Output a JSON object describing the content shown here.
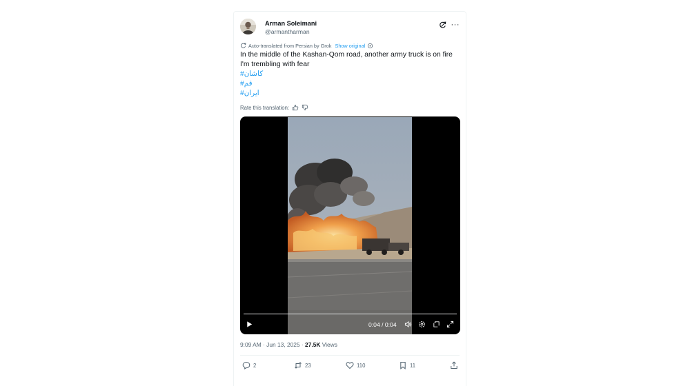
{
  "tweet": {
    "author": {
      "name": "Arman Soleimani",
      "handle": "@armantharman",
      "avatar_icon": "avatar"
    },
    "header_icons": [
      "grok-icon",
      "more-options-icon"
    ],
    "more_label": "···",
    "translation": {
      "note": "Auto-translated from Persian by Grok",
      "show_original": "Show original",
      "rate_label": "Rate this translation:"
    },
    "text": {
      "line1": "In the middle of the Kashan-Qom road, another army truck is on fire",
      "line2": "I'm trembling with fear",
      "hashtags": [
        "#کاشان",
        "#قم",
        "#ایران"
      ]
    },
    "video": {
      "time": "0:04 / 0:04",
      "progress": 1.0,
      "controls": [
        "play-icon",
        "volume-icon",
        "settings-icon",
        "loop-icon",
        "fullscreen-icon"
      ]
    },
    "meta": {
      "time_date": "9:09 AM · Jun 13, 2025 · ",
      "views_count": "27.5K",
      "views_label": " Views"
    },
    "actions": {
      "replies": "2",
      "reposts": "23",
      "likes": "110",
      "bookmarks": "11"
    }
  },
  "colors": {
    "link": "#1d9bf0",
    "secondary_text": "#536471",
    "primary_text": "#0f1419",
    "border": "#eff3f4"
  }
}
